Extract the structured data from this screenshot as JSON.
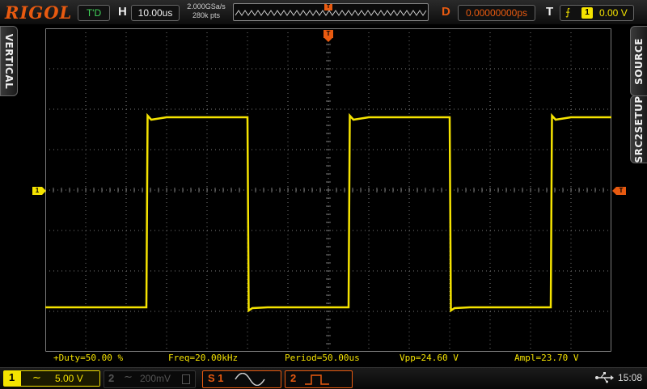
{
  "header": {
    "logo": "RIGOL",
    "status": "T'D",
    "horizontal_label": "H",
    "timebase": "10.00us",
    "sample_rate": "2.000GSa/s",
    "memory_depth": "280k pts",
    "delay_label": "D",
    "delay_value": "0.00000000ps",
    "trigger_label": "T",
    "trigger_source": "1",
    "trigger_level": "0.00 V"
  },
  "side_tabs": {
    "left": "VERTICAL",
    "right_top": "SOURCE",
    "right_bottom": "SRC2SETUP"
  },
  "markers": {
    "channel": "1",
    "trigger": "T"
  },
  "measurements": [
    {
      "text": "+Duty=50.00 %"
    },
    {
      "text": "Freq=20.00kHz"
    },
    {
      "text": "Period=50.00us"
    },
    {
      "text": "Vpp=24.60 V"
    },
    {
      "text": "Ampl=23.70 V"
    }
  ],
  "footer": {
    "ch1": {
      "number": "1",
      "coupling": "~",
      "scale": "5.00 V",
      "color": "#f5e300"
    },
    "ch2": {
      "number": "2",
      "coupling": "~",
      "scale": "200mV"
    },
    "math1_label": "S 1",
    "math2_label": "2",
    "time": "15:08"
  },
  "colors": {
    "trace": "#f5e300",
    "accent": "#e85a10",
    "grid": "#7a7a7a"
  },
  "waveform": {
    "type": "square",
    "period_divisions": 5,
    "high_division": 1.8,
    "low_division": -2.9
  }
}
